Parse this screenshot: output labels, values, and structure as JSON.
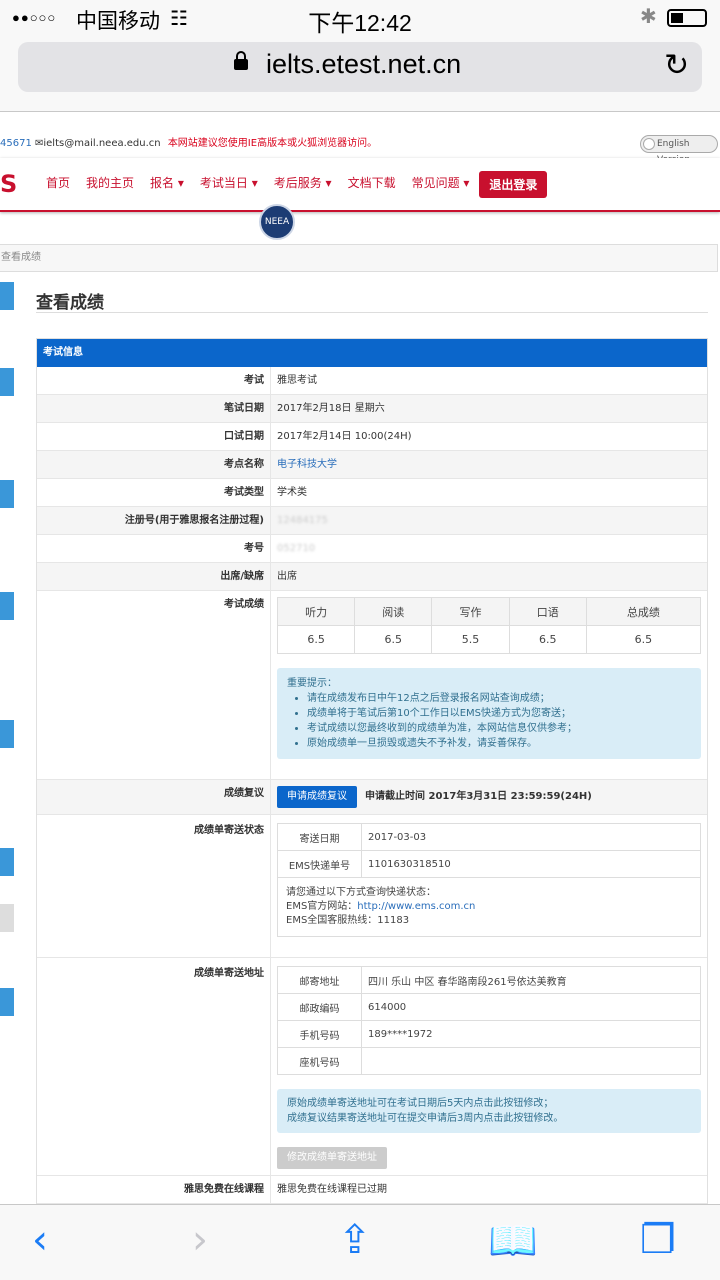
{
  "status": {
    "signal": "●●○○○",
    "carrier": "中国移动",
    "wifi": "((·))",
    "time": "下午12:42",
    "bluetooth": "✱"
  },
  "browser": {
    "url": "ielts.etest.net.cn",
    "reload": "↻"
  },
  "topbar": {
    "phone": "45671",
    "email": "✉ielts@mail.neea.edu.cn",
    "warning": "本网站建议您使用IE高版本或火狐浏览器访问。",
    "english": "English Version"
  },
  "nav": {
    "logo": "S",
    "items": [
      "首页",
      "我的主页",
      "报名 ▾",
      "考试当日 ▾",
      "考后服务 ▾",
      "文档下载",
      "常见问题 ▾"
    ],
    "exit": "退出登录",
    "emblem": "NEEA"
  },
  "breadcrumb": "查看成绩",
  "page_title": "查看成绩",
  "card_title": "考试信息",
  "rows": [
    {
      "label": "考试",
      "value": "雅思考试"
    },
    {
      "label": "笔试日期",
      "value": "2017年2月18日 星期六"
    },
    {
      "label": "口试日期",
      "value": "2017年2月14日 10:00(24H)"
    },
    {
      "label": "考点名称",
      "value": "电子科技大学"
    },
    {
      "label": "考试类型",
      "value": "学术类"
    },
    {
      "label": "注册号(用于雅思报名注册过程)",
      "value": "12484175"
    },
    {
      "label": "考号",
      "value": "052710"
    },
    {
      "label": "出席/缺席",
      "value": "出席"
    }
  ],
  "scores": {
    "label": "考试成绩",
    "headers": [
      "听力",
      "阅读",
      "写作",
      "口语",
      "总成绩"
    ],
    "values": [
      "6.5",
      "6.5",
      "5.5",
      "6.5",
      "6.5"
    ]
  },
  "notice": {
    "title": "重要提示：",
    "items": [
      "请在成绩发布日中午12点之后登录报名网站查询成绩；",
      "成绩单将于笔试后第10个工作日以EMS快递方式为您寄送；",
      "考试成绩以您最终收到的成绩单为准，本网站信息仅供参考；",
      "原始成绩单一旦损毁或遗失不予补发，请妥善保存。"
    ]
  },
  "review": {
    "label": "成绩复议",
    "button": "申请成绩复议",
    "deadline": "申请截止时间 2017年3月31日 23:59:59(24H)"
  },
  "delivery": {
    "label": "成绩单寄送状态",
    "rows": [
      {
        "k": "寄送日期",
        "v": "2017-03-03"
      },
      {
        "k": "EMS快递单号",
        "v": "1101630318510"
      }
    ],
    "info1": "请您通过以下方式查询快递状态：",
    "info2": "EMS官方网站：",
    "info2_link": "http://www.ems.com.cn",
    "info3": "EMS全国客服热线：11183"
  },
  "address": {
    "label": "成绩单寄送地址",
    "rows": [
      {
        "k": "邮寄地址",
        "v": "四川 乐山 中区 春华路南段261号依达美教育"
      },
      {
        "k": "邮政编码",
        "v": "614000"
      },
      {
        "k": "手机号码",
        "v": "189****1972"
      },
      {
        "k": "座机号码",
        "v": ""
      }
    ],
    "note1": "原始成绩单寄送地址可在考试日期后5天内点击此按钮修改；",
    "note2": "成绩复议结果寄送地址可在提交申请后3周内点击此按钮修改。",
    "button": "修改成绩单寄送地址"
  },
  "course": {
    "label": "雅思免费在线课程",
    "value": "雅思免费在线课程已过期"
  },
  "toolbar": {
    "back": "‹",
    "forward": "›",
    "share": "⇪",
    "book": "📖",
    "tabs": "❐"
  }
}
